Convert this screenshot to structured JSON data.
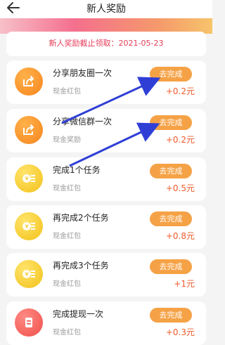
{
  "header": {
    "title": "新人奖励",
    "back_icon": "arrow-left-icon"
  },
  "notice": "新人奖励截止领取：2021-05-23",
  "items": [
    {
      "title": "分享朋友圈一次",
      "subtitle": "现金红包",
      "button": "去完成",
      "reward": "+0.2元",
      "icon": "share-icon",
      "icon_color": "orange"
    },
    {
      "title": "分享微信群一次",
      "subtitle": "现金奖励",
      "button": "去完成",
      "reward": "+0.2元",
      "icon": "share-icon",
      "icon_color": "orange"
    },
    {
      "title": "完成1个任务",
      "subtitle": "现金红包",
      "button": "去完成",
      "reward": "+0.5元",
      "icon": "coins-icon",
      "icon_color": "yellow"
    },
    {
      "title": "再完成2个任务",
      "subtitle": "现金红包",
      "button": "去完成",
      "reward": "+0.8元",
      "icon": "coins-icon",
      "icon_color": "yellow"
    },
    {
      "title": "再完成3个任务",
      "subtitle": "现金红包",
      "button": "去完成",
      "reward": "+1元",
      "icon": "coins-icon",
      "icon_color": "yellow"
    },
    {
      "title": "完成提现一次",
      "subtitle": "现金红包",
      "button": "去完成",
      "reward": "+0.3元",
      "icon": "withdraw-icon",
      "icon_color": "red"
    }
  ],
  "colors": {
    "accent": "#f5a246",
    "reward": "#ef5a2a",
    "notice": "#e53b58",
    "arrow": "#2f3fd6"
  }
}
